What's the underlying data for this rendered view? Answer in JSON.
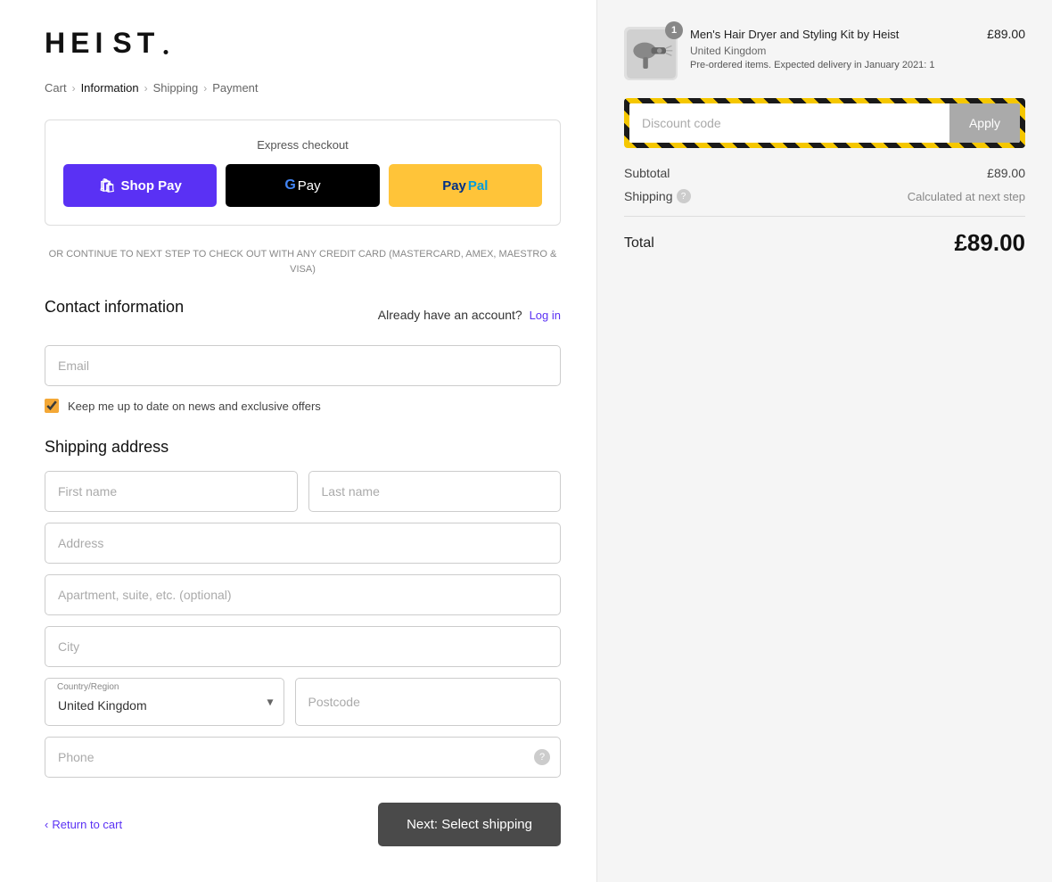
{
  "logo": {
    "text": "HEIST"
  },
  "breadcrumb": {
    "cart": "Cart",
    "information": "Information",
    "shipping": "Shipping",
    "payment": "Payment"
  },
  "express": {
    "title": "Express checkout",
    "shop_pay": "Shop Pay",
    "google_pay": "GPay",
    "paypal": "PayPal"
  },
  "or_text": "OR CONTINUE TO NEXT STEP TO CHECK OUT WITH ANY CREDIT CARD (MASTERCARD, AMEX, MAESTRO & VISA)",
  "contact": {
    "title": "Contact information",
    "already_account": "Already have an account?",
    "login": "Log in",
    "email_placeholder": "Email",
    "newsletter_label": "Keep me up to date on news and exclusive offers"
  },
  "shipping": {
    "title": "Shipping address",
    "first_name_placeholder": "First name",
    "last_name_placeholder": "Last name",
    "address_placeholder": "Address",
    "apt_placeholder": "Apartment, suite, etc. (optional)",
    "city_placeholder": "City",
    "country_label": "Country/Region",
    "country_value": "United Kingdom",
    "postcode_placeholder": "Postcode",
    "phone_placeholder": "Phone"
  },
  "footer": {
    "return_link": "Return to cart",
    "next_button": "Next: Select shipping"
  },
  "product": {
    "name": "Men's Hair Dryer and Styling Kit by Heist",
    "variant": "United Kingdom",
    "note": "Pre-ordered items. Expected delivery in January 2021: 1",
    "price": "£89.00",
    "badge": "1"
  },
  "discount": {
    "placeholder": "Discount code",
    "apply_label": "Apply"
  },
  "summary": {
    "subtotal_label": "Subtotal",
    "subtotal_value": "£89.00",
    "shipping_label": "Shipping",
    "shipping_value": "Calculated at next step",
    "total_label": "Total",
    "total_value": "£89.00"
  }
}
